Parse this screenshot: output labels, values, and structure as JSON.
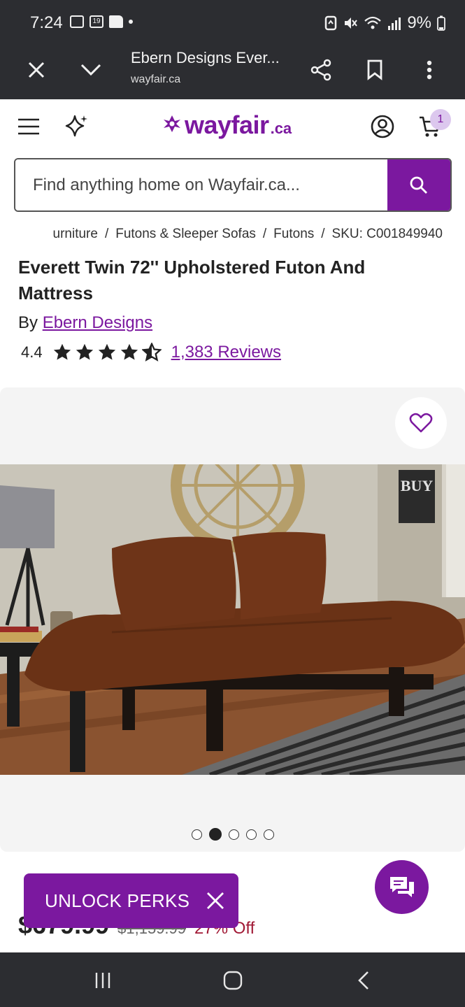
{
  "status_bar": {
    "time": "7:24",
    "calendar_day": "19",
    "battery": "9%"
  },
  "browser": {
    "tab_title": "Ebern Designs Ever...",
    "url": "wayfair.ca"
  },
  "header": {
    "logo_word": "wayfair",
    "logo_suffix": ".ca",
    "cart_count": "1"
  },
  "search": {
    "placeholder": "Find anything home on Wayfair.ca..."
  },
  "breadcrumb": [
    "urniture",
    "Futons & Sleeper Sofas",
    "Futons",
    "SKU: C001849940"
  ],
  "product": {
    "title": "Everett Twin 72'' Upholstered Futon And Mattress",
    "by_label": "By",
    "brand": "Ebern Designs",
    "rating": "4.4",
    "reviews": "1,383 Reviews",
    "rating_value": 4.4,
    "price": "$679.99",
    "was_price": "$1,159.99",
    "discount": "27% Off"
  },
  "gallery": {
    "slide_count": 5,
    "active_index": 1
  },
  "perks": {
    "label": "UNLOCK PERKS"
  },
  "colors": {
    "brand": "#7b189f",
    "chrome": "#2c2d31",
    "sale": "#a11a36"
  }
}
